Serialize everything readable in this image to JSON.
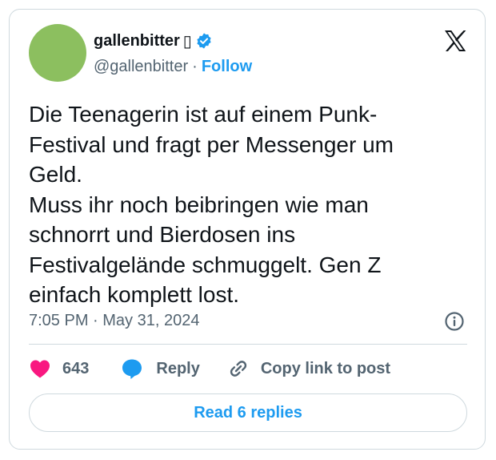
{
  "author": {
    "display_name": "gallenbitter",
    "name_glyph": "▯",
    "handle": "@gallenbitter",
    "separator": "·",
    "follow_label": "Follow"
  },
  "tweet": {
    "text": "Die Teenagerin ist auf einem Punk-\nFestival und fragt per Messenger um\nGeld.\nMuss ihr noch beibringen wie man\nschnorrt und Bierdosen ins\nFestivalgelände schmuggelt. Gen Z\neinfach komplett lost.",
    "timestamp": "7:05 PM · May 31, 2024"
  },
  "actions": {
    "like_count": "643",
    "reply_label": "Reply",
    "copy_link_label": "Copy link to post"
  },
  "read_replies_label": "Read 6 replies",
  "colors": {
    "accent": "#1d9bf0",
    "like": "#f91880",
    "text": "#0f1419",
    "muted": "#536471",
    "border": "#cfd9de",
    "avatar": "#8cbf5f"
  },
  "icons": [
    "verified-badge-icon",
    "x-logo-icon",
    "info-icon",
    "heart-icon",
    "reply-bubble-icon",
    "link-icon"
  ]
}
